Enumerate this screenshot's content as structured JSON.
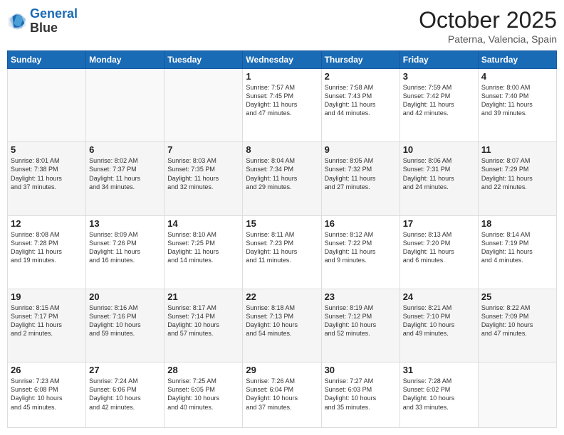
{
  "header": {
    "logo_line1": "General",
    "logo_line2": "Blue",
    "month_title": "October 2025",
    "location": "Paterna, Valencia, Spain"
  },
  "weekdays": [
    "Sunday",
    "Monday",
    "Tuesday",
    "Wednesday",
    "Thursday",
    "Friday",
    "Saturday"
  ],
  "weeks": [
    [
      {
        "day": "",
        "info": ""
      },
      {
        "day": "",
        "info": ""
      },
      {
        "day": "",
        "info": ""
      },
      {
        "day": "1",
        "info": "Sunrise: 7:57 AM\nSunset: 7:45 PM\nDaylight: 11 hours\nand 47 minutes."
      },
      {
        "day": "2",
        "info": "Sunrise: 7:58 AM\nSunset: 7:43 PM\nDaylight: 11 hours\nand 44 minutes."
      },
      {
        "day": "3",
        "info": "Sunrise: 7:59 AM\nSunset: 7:42 PM\nDaylight: 11 hours\nand 42 minutes."
      },
      {
        "day": "4",
        "info": "Sunrise: 8:00 AM\nSunset: 7:40 PM\nDaylight: 11 hours\nand 39 minutes."
      }
    ],
    [
      {
        "day": "5",
        "info": "Sunrise: 8:01 AM\nSunset: 7:38 PM\nDaylight: 11 hours\nand 37 minutes."
      },
      {
        "day": "6",
        "info": "Sunrise: 8:02 AM\nSunset: 7:37 PM\nDaylight: 11 hours\nand 34 minutes."
      },
      {
        "day": "7",
        "info": "Sunrise: 8:03 AM\nSunset: 7:35 PM\nDaylight: 11 hours\nand 32 minutes."
      },
      {
        "day": "8",
        "info": "Sunrise: 8:04 AM\nSunset: 7:34 PM\nDaylight: 11 hours\nand 29 minutes."
      },
      {
        "day": "9",
        "info": "Sunrise: 8:05 AM\nSunset: 7:32 PM\nDaylight: 11 hours\nand 27 minutes."
      },
      {
        "day": "10",
        "info": "Sunrise: 8:06 AM\nSunset: 7:31 PM\nDaylight: 11 hours\nand 24 minutes."
      },
      {
        "day": "11",
        "info": "Sunrise: 8:07 AM\nSunset: 7:29 PM\nDaylight: 11 hours\nand 22 minutes."
      }
    ],
    [
      {
        "day": "12",
        "info": "Sunrise: 8:08 AM\nSunset: 7:28 PM\nDaylight: 11 hours\nand 19 minutes."
      },
      {
        "day": "13",
        "info": "Sunrise: 8:09 AM\nSunset: 7:26 PM\nDaylight: 11 hours\nand 16 minutes."
      },
      {
        "day": "14",
        "info": "Sunrise: 8:10 AM\nSunset: 7:25 PM\nDaylight: 11 hours\nand 14 minutes."
      },
      {
        "day": "15",
        "info": "Sunrise: 8:11 AM\nSunset: 7:23 PM\nDaylight: 11 hours\nand 11 minutes."
      },
      {
        "day": "16",
        "info": "Sunrise: 8:12 AM\nSunset: 7:22 PM\nDaylight: 11 hours\nand 9 minutes."
      },
      {
        "day": "17",
        "info": "Sunrise: 8:13 AM\nSunset: 7:20 PM\nDaylight: 11 hours\nand 6 minutes."
      },
      {
        "day": "18",
        "info": "Sunrise: 8:14 AM\nSunset: 7:19 PM\nDaylight: 11 hours\nand 4 minutes."
      }
    ],
    [
      {
        "day": "19",
        "info": "Sunrise: 8:15 AM\nSunset: 7:17 PM\nDaylight: 11 hours\nand 2 minutes."
      },
      {
        "day": "20",
        "info": "Sunrise: 8:16 AM\nSunset: 7:16 PM\nDaylight: 10 hours\nand 59 minutes."
      },
      {
        "day": "21",
        "info": "Sunrise: 8:17 AM\nSunset: 7:14 PM\nDaylight: 10 hours\nand 57 minutes."
      },
      {
        "day": "22",
        "info": "Sunrise: 8:18 AM\nSunset: 7:13 PM\nDaylight: 10 hours\nand 54 minutes."
      },
      {
        "day": "23",
        "info": "Sunrise: 8:19 AM\nSunset: 7:12 PM\nDaylight: 10 hours\nand 52 minutes."
      },
      {
        "day": "24",
        "info": "Sunrise: 8:21 AM\nSunset: 7:10 PM\nDaylight: 10 hours\nand 49 minutes."
      },
      {
        "day": "25",
        "info": "Sunrise: 8:22 AM\nSunset: 7:09 PM\nDaylight: 10 hours\nand 47 minutes."
      }
    ],
    [
      {
        "day": "26",
        "info": "Sunrise: 7:23 AM\nSunset: 6:08 PM\nDaylight: 10 hours\nand 45 minutes."
      },
      {
        "day": "27",
        "info": "Sunrise: 7:24 AM\nSunset: 6:06 PM\nDaylight: 10 hours\nand 42 minutes."
      },
      {
        "day": "28",
        "info": "Sunrise: 7:25 AM\nSunset: 6:05 PM\nDaylight: 10 hours\nand 40 minutes."
      },
      {
        "day": "29",
        "info": "Sunrise: 7:26 AM\nSunset: 6:04 PM\nDaylight: 10 hours\nand 37 minutes."
      },
      {
        "day": "30",
        "info": "Sunrise: 7:27 AM\nSunset: 6:03 PM\nDaylight: 10 hours\nand 35 minutes."
      },
      {
        "day": "31",
        "info": "Sunrise: 7:28 AM\nSunset: 6:02 PM\nDaylight: 10 hours\nand 33 minutes."
      },
      {
        "day": "",
        "info": ""
      }
    ]
  ]
}
